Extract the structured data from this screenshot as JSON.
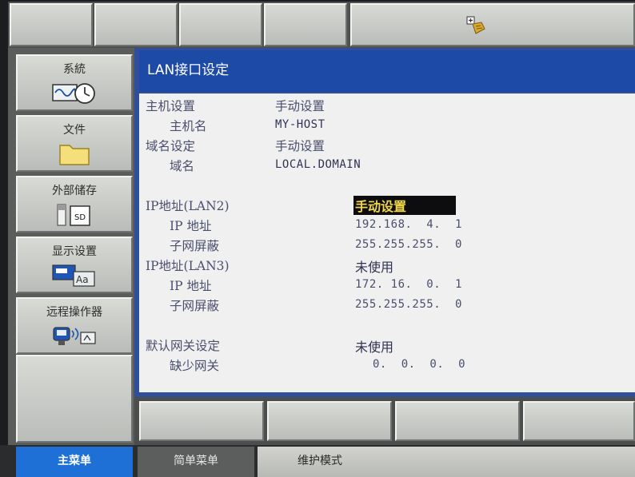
{
  "window": {
    "title": "LAN接口设定"
  },
  "toolbar": {
    "icon": "puzzle-plugin-icon"
  },
  "sidebar": {
    "items": [
      {
        "label": "系統",
        "icon": "waveform-clock-icon"
      },
      {
        "label": "文件",
        "icon": "folder-icon"
      },
      {
        "label": "外部储存",
        "icon": "sd-card-icon"
      },
      {
        "label": "显示设置",
        "icon": "display-text-icon"
      },
      {
        "label": "远程操作器",
        "icon": "remote-pendant-icon"
      }
    ]
  },
  "settings": {
    "host_setting": {
      "label": "主机设置",
      "value": "手动设置"
    },
    "host_name": {
      "label": "主机名",
      "value": "MY-HOST"
    },
    "domain_setting": {
      "label": "域名设定",
      "value": "手动设置"
    },
    "domain_name": {
      "label": "域名",
      "value": "LOCAL.DOMAIN"
    },
    "lan2": {
      "label": "IP地址(LAN2)",
      "value": "手动设置",
      "ip": {
        "label": "IP 地址",
        "value": "192.168.  4.  1"
      },
      "mask": {
        "label": "子网屏蔽",
        "value": "255.255.255.  0"
      }
    },
    "lan3": {
      "label": "IP地址(LAN3)",
      "value": "未使用",
      "ip": {
        "label": "IP 地址",
        "value": "172. 16.  0.  1"
      },
      "mask": {
        "label": "子网屏蔽",
        "value": "255.255.255.  0"
      }
    },
    "gateway": {
      "label": "默认网关设定",
      "value": "未使用",
      "default": {
        "label": "缺少网关",
        "value": "0.  0.  0.  0"
      }
    }
  },
  "tabs": {
    "main_menu": "主菜单",
    "simple_menu": "简单菜单",
    "maintenance": "维护模式"
  },
  "colors": {
    "accent": "#1e6fd6",
    "title_bar": "#1d4aa6",
    "selection_text": "#f2d64a"
  }
}
